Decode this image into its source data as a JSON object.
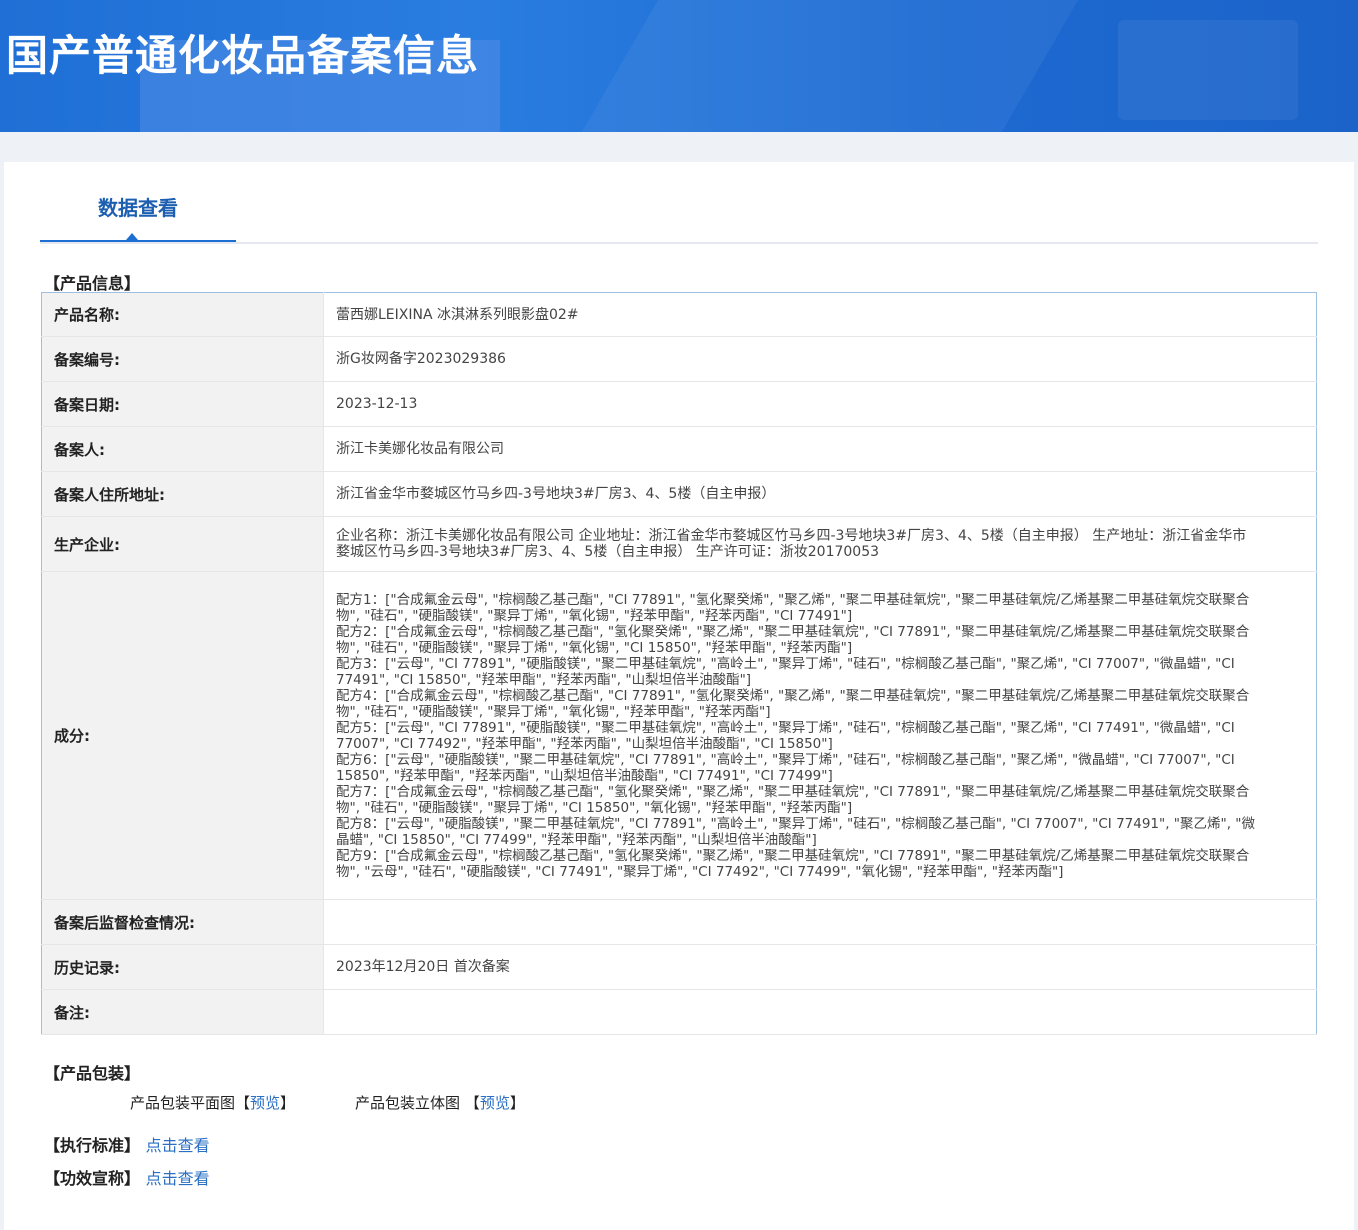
{
  "header": {
    "title": "国产普通化妆品备案信息"
  },
  "tabs": [
    {
      "label": "数据查看"
    }
  ],
  "product_info": {
    "section_title": "【产品信息】",
    "rows": {
      "name": {
        "label": "产品名称:",
        "value": "蕾西娜LEIXINA 冰淇淋系列眼影盘02#"
      },
      "record_no": {
        "label": "备案编号:",
        "value": "浙G妆网备字2023029386"
      },
      "record_date": {
        "label": "备案日期:",
        "value": "2023-12-13"
      },
      "registrant": {
        "label": "备案人:",
        "value": "浙江卡美娜化妆品有限公司"
      },
      "address": {
        "label": "备案人住所地址:",
        "value": "浙江省金华市婺城区竹马乡四-3号地块3#厂房3、4、5楼（自主申报）"
      },
      "manufacturer": {
        "label": "生产企业:",
        "value": "企业名称：浙江卡美娜化妆品有限公司 企业地址：浙江省金华市婺城区竹马乡四-3号地块3#厂房3、4、5楼（自主申报） 生产地址：浙江省金华市婺城区竹马乡四-3号地块3#厂房3、4、5楼（自主申报） 生产许可证：浙妆20170053"
      },
      "ingredients": {
        "label": "成分:",
        "formulas": [
          "配方1：[\"合成氟金云母\", \"棕榈酸乙基己酯\", \"CI 77891\", \"氢化聚癸烯\", \"聚乙烯\", \"聚二甲基硅氧烷\", \"聚二甲基硅氧烷/乙烯基聚二甲基硅氧烷交联聚合物\", \"硅石\", \"硬脂酸镁\", \"聚异丁烯\", \"氧化锡\", \"羟苯甲酯\", \"羟苯丙酯\", \"CI 77491\"]",
          "配方2：[\"合成氟金云母\", \"棕榈酸乙基己酯\", \"氢化聚癸烯\", \"聚乙烯\", \"聚二甲基硅氧烷\", \"CI 77891\", \"聚二甲基硅氧烷/乙烯基聚二甲基硅氧烷交联聚合物\", \"硅石\", \"硬脂酸镁\", \"聚异丁烯\", \"氧化锡\", \"CI 15850\", \"羟苯甲酯\", \"羟苯丙酯\"]",
          "配方3：[\"云母\", \"CI 77891\", \"硬脂酸镁\", \"聚二甲基硅氧烷\", \"高岭土\", \"聚异丁烯\", \"硅石\", \"棕榈酸乙基己酯\", \"聚乙烯\", \"CI 77007\", \"微晶蜡\", \"CI 77491\", \"CI 15850\", \"羟苯甲酯\", \"羟苯丙酯\", \"山梨坦倍半油酸酯\"]",
          "配方4：[\"合成氟金云母\", \"棕榈酸乙基己酯\", \"CI 77891\", \"氢化聚癸烯\", \"聚乙烯\", \"聚二甲基硅氧烷\", \"聚二甲基硅氧烷/乙烯基聚二甲基硅氧烷交联聚合物\", \"硅石\", \"硬脂酸镁\", \"聚异丁烯\", \"氧化锡\", \"羟苯甲酯\", \"羟苯丙酯\"]",
          "配方5：[\"云母\", \"CI 77891\", \"硬脂酸镁\", \"聚二甲基硅氧烷\", \"高岭土\", \"聚异丁烯\", \"硅石\", \"棕榈酸乙基己酯\", \"聚乙烯\", \"CI 77491\", \"微晶蜡\", \"CI 77007\", \"CI 77492\", \"羟苯甲酯\", \"羟苯丙酯\", \"山梨坦倍半油酸酯\", \"CI 15850\"]",
          "配方6：[\"云母\", \"硬脂酸镁\", \"聚二甲基硅氧烷\", \"CI 77891\", \"高岭土\", \"聚异丁烯\", \"硅石\", \"棕榈酸乙基己酯\", \"聚乙烯\", \"微晶蜡\", \"CI 77007\", \"CI 15850\", \"羟苯甲酯\", \"羟苯丙酯\", \"山梨坦倍半油酸酯\", \"CI 77491\", \"CI 77499\"]",
          "配方7：[\"合成氟金云母\", \"棕榈酸乙基己酯\", \"氢化聚癸烯\", \"聚乙烯\", \"聚二甲基硅氧烷\", \"CI 77891\", \"聚二甲基硅氧烷/乙烯基聚二甲基硅氧烷交联聚合物\", \"硅石\", \"硬脂酸镁\", \"聚异丁烯\", \"CI 15850\", \"氧化锡\", \"羟苯甲酯\", \"羟苯丙酯\"]",
          "配方8：[\"云母\", \"硬脂酸镁\", \"聚二甲基硅氧烷\", \"CI 77891\", \"高岭土\", \"聚异丁烯\", \"硅石\", \"棕榈酸乙基己酯\", \"CI 77007\", \"CI 77491\", \"聚乙烯\", \"微晶蜡\", \"CI 15850\", \"CI 77499\", \"羟苯甲酯\", \"羟苯丙酯\", \"山梨坦倍半油酸酯\"]",
          "配方9：[\"合成氟金云母\", \"棕榈酸乙基己酯\", \"氢化聚癸烯\", \"聚乙烯\", \"聚二甲基硅氧烷\", \"CI 77891\", \"聚二甲基硅氧烷/乙烯基聚二甲基硅氧烷交联聚合物\", \"云母\", \"硅石\", \"硬脂酸镁\", \"CI 77491\", \"聚异丁烯\", \"CI 77492\", \"CI 77499\", \"氧化锡\", \"羟苯甲酯\", \"羟苯丙酯\"]"
        ]
      },
      "inspection": {
        "label": "备案后监督检查情况:",
        "value": ""
      },
      "history": {
        "label": "历史记录:",
        "value": "2023年12月20日 首次备案"
      },
      "remarks": {
        "label": "备注:",
        "value": ""
      }
    }
  },
  "packaging": {
    "section_title": "【产品包装】",
    "flat_label": "产品包装平面图",
    "stereo_label": "产品包装立体图",
    "bracket_open": "【",
    "bracket_close": "】",
    "preview_link": "预览"
  },
  "standard": {
    "section_title": "【执行标准】",
    "link": "点击查看"
  },
  "efficacy": {
    "section_title": "【功效宣称】",
    "link": "点击查看"
  },
  "colors": {
    "banner": "#1f6fd6",
    "tab_active": "#1c6fd0",
    "link": "#2a6fc4",
    "key_bg": "#f2f2f2",
    "table_border": "#9fbfe0"
  }
}
